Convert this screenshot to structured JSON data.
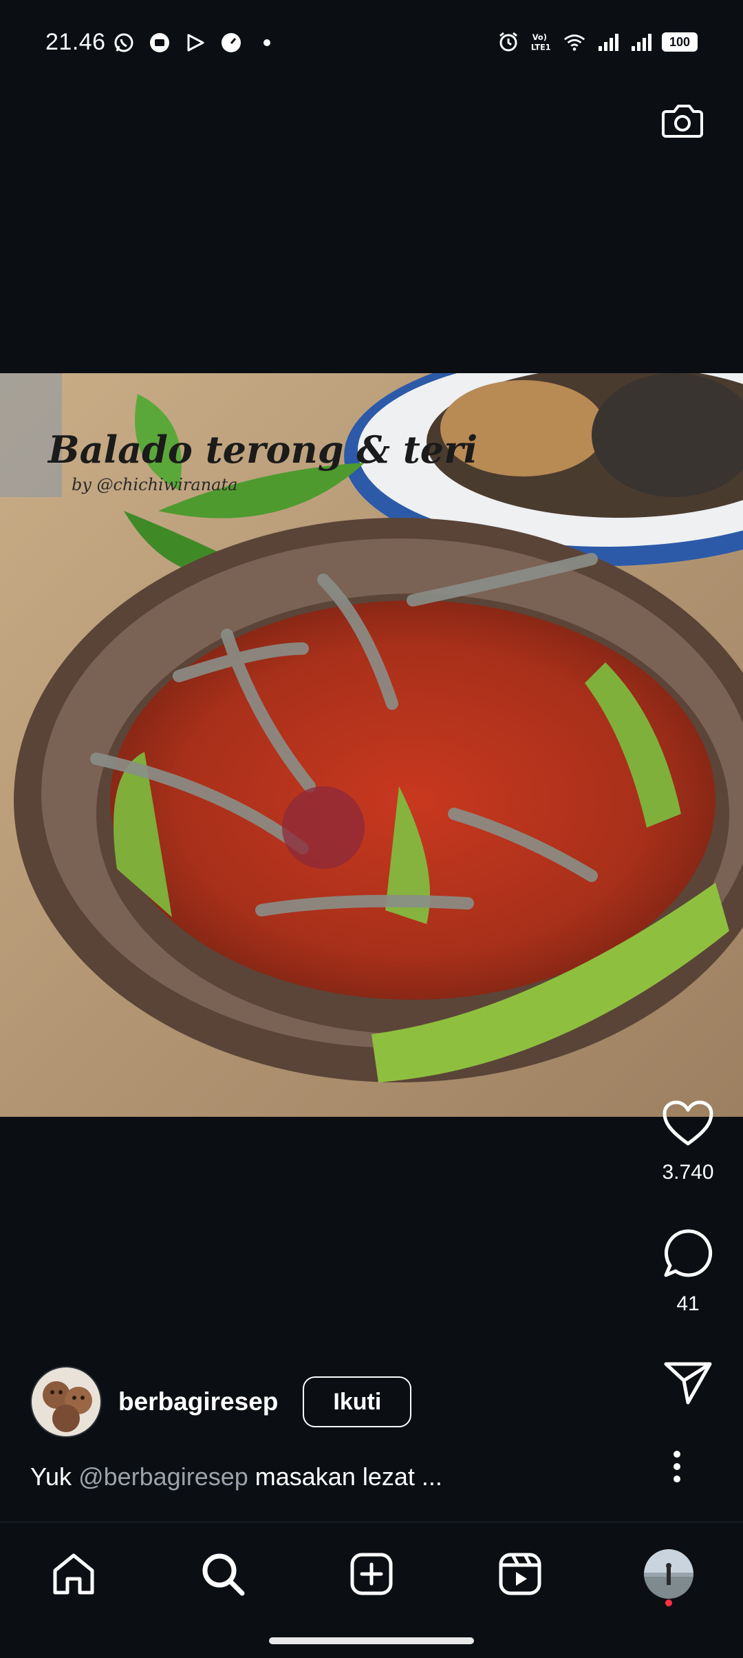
{
  "status_bar": {
    "time": "21.46",
    "battery": "100",
    "network_label": "LTE1"
  },
  "post": {
    "image_overlay_title": "Balado terong & teri",
    "image_overlay_credit": "by @chichiwiranata",
    "likes": "3.740",
    "comments": "41"
  },
  "author": {
    "username": "berbagiresep",
    "follow_label": "Ikuti"
  },
  "caption": {
    "prefix": "Yuk ",
    "mention": "@berbagiresep",
    "rest": " masakan lezat ..."
  },
  "colors": {
    "background": "#0b0f14",
    "text": "#ffffff",
    "mention": "#9aa3ad",
    "notification": "#ff3040"
  },
  "icons": {
    "camera": "camera-icon",
    "like": "heart-icon",
    "comment": "comment-icon",
    "share": "send-icon",
    "more": "more-vertical-icon",
    "home": "home-icon",
    "search": "search-icon",
    "create": "plus-square-icon",
    "reels": "reels-icon"
  }
}
